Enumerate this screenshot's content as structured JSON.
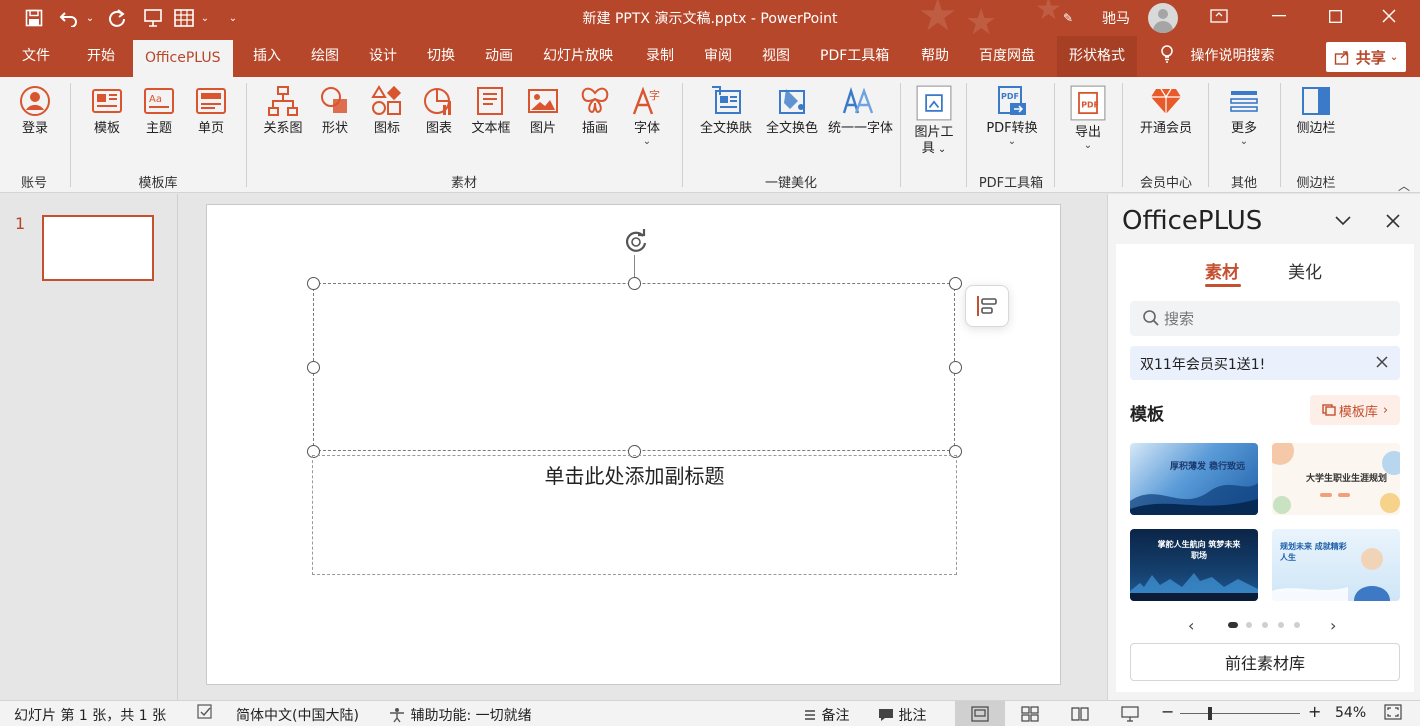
{
  "window": {
    "title": "新建 PPTX 演示文稿.pptx  -  PowerPoint",
    "user": "驰马",
    "qat_icons": [
      "save-icon",
      "undo-icon",
      "redo-icon",
      "present-icon",
      "table-icon",
      "customize-icon"
    ]
  },
  "tabs": [
    "文件",
    "开始",
    "OfficePLUS",
    "插入",
    "绘图",
    "设计",
    "切换",
    "动画",
    "幻灯片放映",
    "录制",
    "审阅",
    "视图",
    "PDF工具箱",
    "帮助",
    "百度网盘",
    "形状格式"
  ],
  "active_tab": "OfficePLUS",
  "search_tab": "操作说明搜索",
  "share_label": "共享",
  "ribbon": {
    "buttons": [
      "登录",
      "模板",
      "主题",
      "单页",
      "关系图",
      "形状",
      "图标",
      "图表",
      "文本框",
      "图片",
      "插画",
      "字体",
      "全文换肤",
      "全文换色",
      "统一一字体",
      "图片工",
      "具",
      "PDF转换",
      "导出",
      "开通会员",
      "更多",
      "侧边栏"
    ],
    "groups": [
      "账号",
      "模板库",
      "素材",
      "一键美化",
      "PDF工具箱",
      "会员中心",
      "其他",
      "侧边栏"
    ]
  },
  "thumbs": {
    "slide_number": "1"
  },
  "canvas": {
    "subtitle_placeholder": "单击此处添加副标题"
  },
  "pane": {
    "title": "OfficePLUS",
    "tabs": [
      "素材",
      "美化"
    ],
    "search_placeholder": "搜索",
    "promo": "双11年会员买1送1!",
    "section_title": "模板",
    "library_button": "模板库",
    "templates": [
      {
        "text": "厚积薄发 稳行致远"
      },
      {
        "text": "大学生职业生涯规划"
      },
      {
        "text": "掌舵人生航向 筑梦未来职场"
      },
      {
        "text": "规划未来 成就精彩人生"
      }
    ],
    "goto_button": "前往素材库"
  },
  "status": {
    "slide_info": "幻灯片 第 1 张，共 1 张",
    "language": "简体中文(中国大陆)",
    "accessibility": "辅助功能: 一切就绪",
    "notes": "备注",
    "comments": "批注",
    "zoom": "54%"
  },
  "colors": {
    "accent": "#b7472a",
    "accent_light": "#c4502f"
  }
}
